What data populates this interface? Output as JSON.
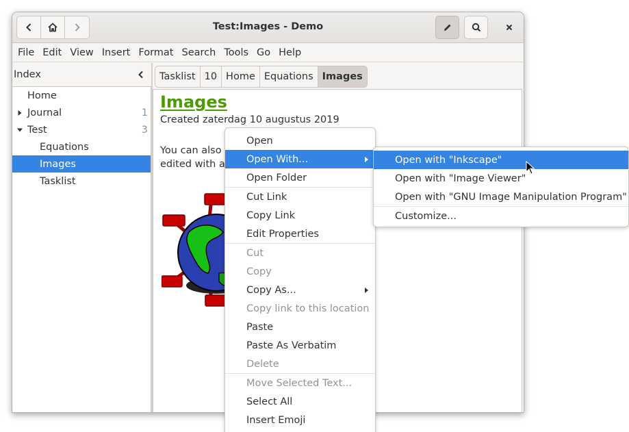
{
  "window": {
    "title": "Test:Images - Demo",
    "nav_buttons": [
      {
        "name": "back",
        "icon": "chevron-left-icon"
      },
      {
        "name": "home",
        "icon": "home-icon"
      },
      {
        "name": "forward",
        "icon": "chevron-right-icon"
      }
    ],
    "header_actions": [
      {
        "name": "edit",
        "icon": "pencil-icon",
        "active": true
      },
      {
        "name": "search",
        "icon": "search-icon"
      },
      {
        "name": "close",
        "icon": "close-icon"
      }
    ]
  },
  "menubar": [
    "File",
    "Edit",
    "View",
    "Insert",
    "Format",
    "Search",
    "Tools",
    "Go",
    "Help"
  ],
  "sidebar": {
    "title": "Index",
    "collapse_icon": "chevron-left-icon",
    "items": [
      {
        "label": "Home",
        "level": 0,
        "expander": "",
        "count": ""
      },
      {
        "label": "Journal",
        "level": 0,
        "expander": "collapsed",
        "count": "1"
      },
      {
        "label": "Test",
        "level": 0,
        "expander": "expanded",
        "count": "3"
      },
      {
        "label": "Equations",
        "level": 1,
        "expander": "",
        "count": ""
      },
      {
        "label": "Images",
        "level": 1,
        "expander": "",
        "count": "",
        "selected": true
      },
      {
        "label": "Tasklist",
        "level": 1,
        "expander": "",
        "count": ""
      }
    ]
  },
  "pathbar": [
    {
      "label": "Tasklist"
    },
    {
      "label": "10"
    },
    {
      "label": "Home"
    },
    {
      "label": "Equations"
    },
    {
      "label": "Images",
      "active": true
    }
  ],
  "page": {
    "heading": "Images",
    "created": "Created zaterdag 10 augustus 2019",
    "paragraph_line1": "You can also in",
    "paragraph_line2": "edited with any",
    "heading_color": "#4e9a06"
  },
  "context_menu": {
    "items": [
      {
        "label": "Open",
        "enabled": true
      },
      {
        "label": "Open With...",
        "enabled": true,
        "submenu": true,
        "highlighted": true
      },
      {
        "label": "Open Folder",
        "enabled": true
      },
      {
        "separator": true
      },
      {
        "label": "Cut Link",
        "enabled": true
      },
      {
        "label": "Copy Link",
        "enabled": true
      },
      {
        "label": "Edit Properties",
        "enabled": true
      },
      {
        "separator": true
      },
      {
        "label": "Cut",
        "enabled": false
      },
      {
        "label": "Copy",
        "enabled": false
      },
      {
        "label": "Copy As...",
        "enabled": true,
        "submenu": true
      },
      {
        "label": "Copy link to this location",
        "enabled": false
      },
      {
        "label": "Paste",
        "enabled": true
      },
      {
        "label": "Paste As Verbatim",
        "enabled": true
      },
      {
        "label": "Delete",
        "enabled": false
      },
      {
        "separator": true
      },
      {
        "label": "Move Selected Text...",
        "enabled": false
      },
      {
        "label": "Select All",
        "enabled": true
      },
      {
        "label": "Insert Emoji",
        "enabled": true
      }
    ]
  },
  "open_with_submenu": {
    "items": [
      {
        "label": "Open with \"Inkscape\"",
        "highlighted": true
      },
      {
        "label": "Open with \"Image Viewer\""
      },
      {
        "label": "Open with \"GNU Image Manipulation Program\""
      },
      {
        "separator": true
      },
      {
        "label": "Customize..."
      }
    ]
  },
  "colors": {
    "accent": "#3584e4",
    "disabled_text": "#929595",
    "text": "#2e3436"
  }
}
